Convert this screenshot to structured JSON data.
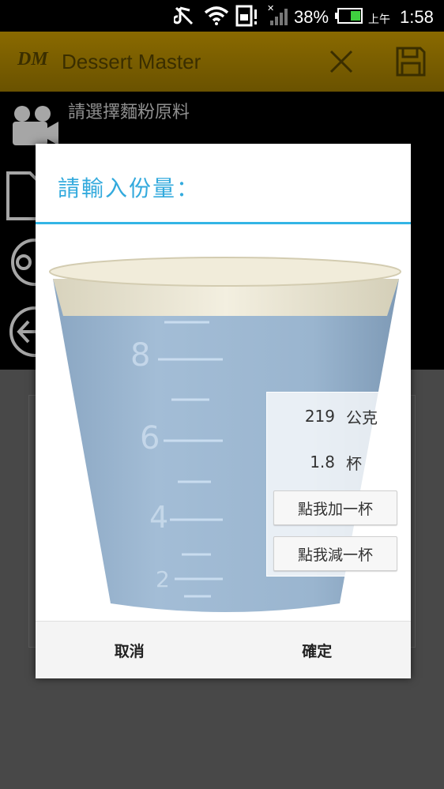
{
  "status_bar": {
    "battery": "38%",
    "am_pm": "上午",
    "time": "1:58"
  },
  "action_bar": {
    "logo": "DM",
    "title": "Dessert Master"
  },
  "background": {
    "prompt": "請選擇麵粉原料"
  },
  "dialog": {
    "title": "請輸入份量：",
    "cup": {
      "scale_labels": [
        "8",
        "6",
        "4",
        "2"
      ],
      "fill_level": 0.85
    },
    "grams_value": "219",
    "grams_unit": "公克",
    "cups_value": "1.8",
    "cups_unit": "杯",
    "add_cup_label": "點我加一杯",
    "remove_cup_label": "點我減一杯",
    "cancel_label": "取消",
    "confirm_label": "確定"
  },
  "colors": {
    "accent": "#33b5e5",
    "action_bar": "#7a5e00",
    "water": "#93b0cc"
  }
}
